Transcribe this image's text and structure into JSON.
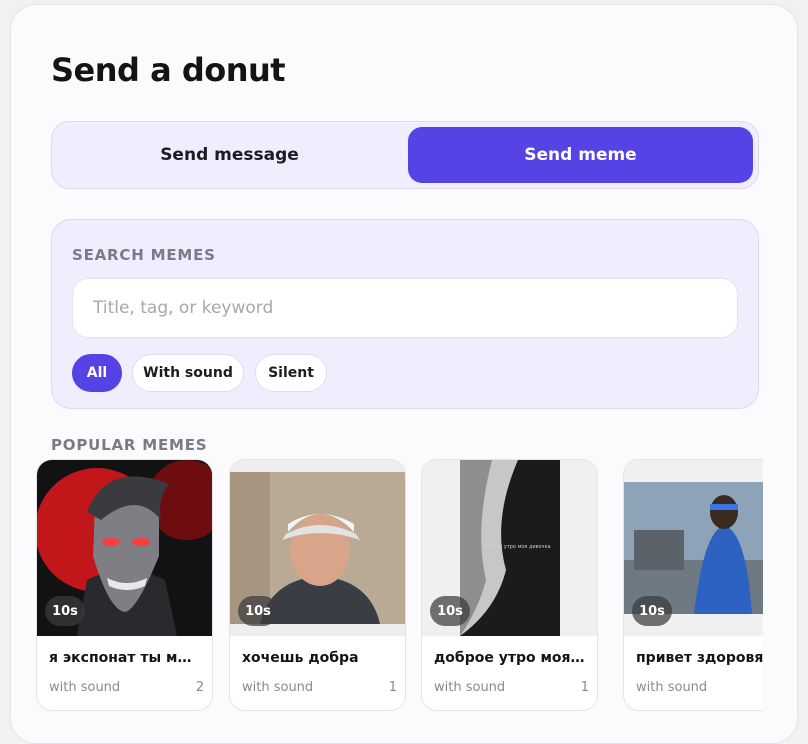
{
  "page": {
    "title": "Send a donut"
  },
  "mode_toggle": {
    "options": [
      {
        "label": "Send message",
        "selected": false
      },
      {
        "label": "Send meme",
        "selected": true
      }
    ]
  },
  "search": {
    "label": "SEARCH MEMES",
    "placeholder": "Title, tag, or keyword",
    "value": "",
    "filters": [
      {
        "label": "All",
        "active": true
      },
      {
        "label": "With sound",
        "active": false
      },
      {
        "label": "Silent",
        "active": false
      }
    ]
  },
  "popular": {
    "label": "POPULAR MEMES",
    "items": [
      {
        "title": "я экспонат ты мо...",
        "duration": "10s",
        "sound": "with sound",
        "count": "2"
      },
      {
        "title": "хочешь добра",
        "duration": "10s",
        "sound": "with sound",
        "count": "1"
      },
      {
        "title": "доброе утро моя...",
        "duration": "10s",
        "sound": "with sound",
        "count": "1",
        "thumb_caption": "доброе утро моя девочка"
      },
      {
        "title": "привет здоровяк",
        "duration": "10s",
        "sound": "with sound",
        "count": ""
      }
    ]
  },
  "colors": {
    "accent": "#5643e6",
    "panel": "#efedfe",
    "card_bg": "#fbfbfd",
    "muted_text": "#8b8992"
  }
}
